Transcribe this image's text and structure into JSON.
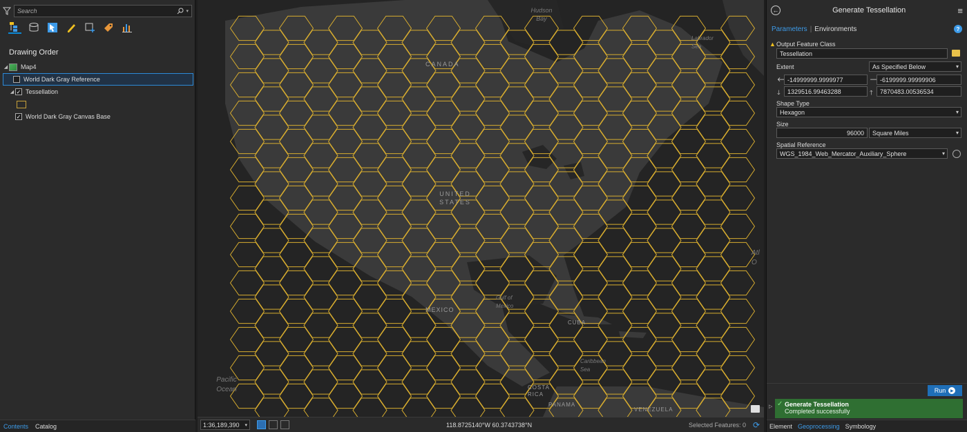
{
  "contents": {
    "search_placeholder": "Search",
    "section_title": "Drawing Order",
    "tree": {
      "map": "Map4",
      "reference_layer": "World Dark Gray Reference",
      "tessellation_layer": "Tessellation",
      "base_layer": "World Dark Gray Canvas Base",
      "checkmark": "✓"
    },
    "tabs": {
      "contents": "Contents",
      "catalog": "Catalog"
    }
  },
  "map": {
    "labels": {
      "hudson_bay": "Hudson Bay",
      "labrador_sea": "Labrador Sea",
      "canada": "CANADA",
      "united_states": "UNITED STATES",
      "mexico": "MEXICO",
      "gulf_of_mexico": "Gulf of Mexico",
      "cuba": "CUBA",
      "caribbean_sea": "Caribbean Sea",
      "pacific_ocean": "Pacific Ocean",
      "costa_rica": "COSTA RICA",
      "panama": "PANAMA",
      "venezuela": "VENEZUELA",
      "atlantic_ocean": "Atl O"
    },
    "hex_color": "#d8ad2f"
  },
  "status_bar": {
    "scale": "1:36,189,390",
    "coordinates": "118.8725140°W 60.3743738°N",
    "selected_features": "Selected Features: 0"
  },
  "geoprocessing": {
    "title": "Generate Tessellation",
    "tabs": {
      "parameters": "Parameters",
      "separator": "|",
      "environments": "Environments"
    },
    "help": "?",
    "output_feature_class": {
      "label": "Output Feature Class",
      "value": "Tessellation"
    },
    "extent": {
      "label": "Extent",
      "mode": "As Specified Below",
      "left": "-14999999.9999977",
      "right": "-6199999.99999906",
      "bottom": "1329516.99463288",
      "top": "7870483.00536534"
    },
    "shape_type": {
      "label": "Shape Type",
      "value": "Hexagon"
    },
    "size": {
      "label": "Size",
      "value": "96000",
      "unit": "Square Miles"
    },
    "spatial_reference": {
      "label": "Spatial Reference",
      "value": "WGS_1984_Web_Mercator_Auxiliary_Sphere"
    },
    "run_label": "Run",
    "result": {
      "title": "Generate Tessellation",
      "status": "Completed successfully"
    },
    "bottom_tabs": {
      "element": "Element",
      "geoprocessing": "Geoprocessing",
      "symbology": "Symbology"
    }
  },
  "colors": {
    "accent": "#3d9be9",
    "success": "#2f6f32",
    "hex_outline": "#d8ad2f",
    "warning": "#f0c020"
  }
}
